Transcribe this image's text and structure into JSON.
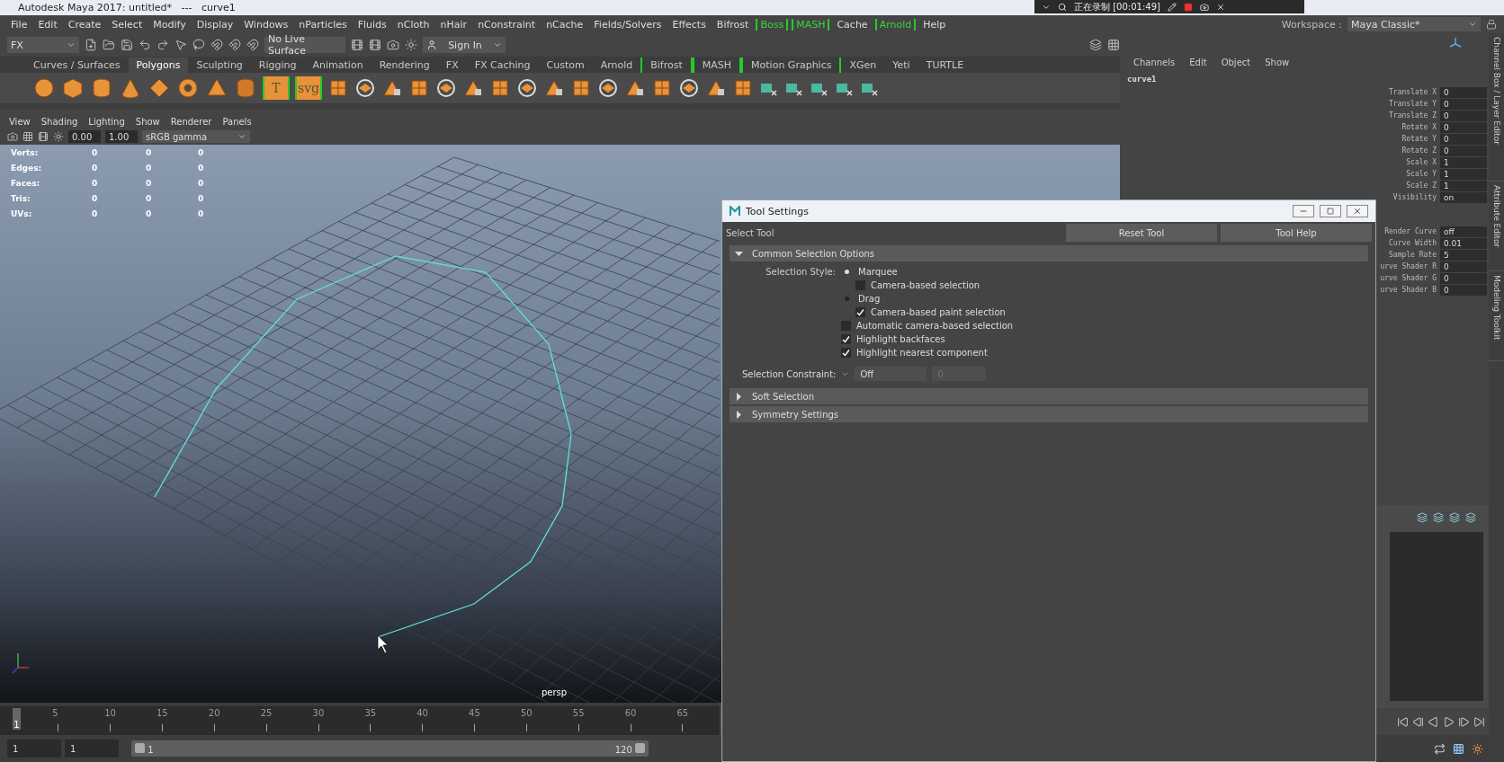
{
  "title_bar": {
    "title": "Autodesk Maya 2017: untitled*   ---   curve1"
  },
  "recorder": {
    "status": "正在录制 [00:01:49]"
  },
  "menu_bar": [
    {
      "label": "File",
      "kind": "plain"
    },
    {
      "label": "Edit",
      "kind": "plain"
    },
    {
      "label": "Create",
      "kind": "plain"
    },
    {
      "label": "Select",
      "kind": "plain"
    },
    {
      "label": "Modify",
      "kind": "plain"
    },
    {
      "label": "Display",
      "kind": "plain"
    },
    {
      "label": "Windows",
      "kind": "plain"
    },
    {
      "label": "nParticles",
      "kind": "plain"
    },
    {
      "label": "Fluids",
      "kind": "plain"
    },
    {
      "label": "nCloth",
      "kind": "plain"
    },
    {
      "label": "nHair",
      "kind": "plain"
    },
    {
      "label": "nConstraint",
      "kind": "plain"
    },
    {
      "label": "nCache",
      "kind": "plain"
    },
    {
      "label": "Fields/Solvers",
      "kind": "plain"
    },
    {
      "label": "Effects",
      "kind": "plain"
    },
    {
      "label": "Bifrost",
      "kind": "plain"
    },
    {
      "label": "Boss",
      "kind": "plugin"
    },
    {
      "label": "MASH",
      "kind": "plugin"
    },
    {
      "label": "Cache",
      "kind": "plain"
    },
    {
      "label": "Arnold",
      "kind": "plugin"
    },
    {
      "label": "Help",
      "kind": "plain"
    }
  ],
  "workspace": {
    "label": "Workspace :",
    "value": "Maya Classic*"
  },
  "status_line": {
    "mode": "FX",
    "live_surface": "No Live Surface",
    "sign_in": "Sign In"
  },
  "shelf_tabs": [
    {
      "label": "Curves / Surfaces",
      "selected": false,
      "kind": "plain"
    },
    {
      "label": "Polygons",
      "selected": true,
      "kind": "plain"
    },
    {
      "label": "Sculpting",
      "selected": false,
      "kind": "plain"
    },
    {
      "label": "Rigging",
      "selected": false,
      "kind": "plain"
    },
    {
      "label": "Animation",
      "selected": false,
      "kind": "plain"
    },
    {
      "label": "Rendering",
      "selected": false,
      "kind": "plain"
    },
    {
      "label": "FX",
      "selected": false,
      "kind": "plain"
    },
    {
      "label": "FX Caching",
      "selected": false,
      "kind": "plain"
    },
    {
      "label": "Custom",
      "selected": false,
      "kind": "plain"
    },
    {
      "label": "Arnold",
      "selected": false,
      "kind": "plain"
    },
    {
      "label": "Bifrost",
      "selected": false,
      "kind": "plugin"
    },
    {
      "label": "MASH",
      "selected": false,
      "kind": "plugin"
    },
    {
      "label": "Motion Graphics",
      "selected": false,
      "kind": "plugin"
    },
    {
      "label": "XGen",
      "selected": false,
      "kind": "plain"
    },
    {
      "label": "Yeti",
      "selected": false,
      "kind": "plain"
    },
    {
      "label": "TURTLE",
      "selected": false,
      "kind": "plain"
    }
  ],
  "shelf_text_tools": [
    "T",
    "svg"
  ],
  "viewport_menu": [
    "View",
    "Shading",
    "Lighting",
    "Show",
    "Renderer",
    "Panels"
  ],
  "viewport_toolbar": {
    "exposure": "0.00",
    "gamma": "1.00",
    "color_space": "sRGB gamma"
  },
  "hud": [
    {
      "label": "Verts:",
      "values": [
        "0",
        "0",
        "0"
      ]
    },
    {
      "label": "Edges:",
      "values": [
        "0",
        "0",
        "0"
      ]
    },
    {
      "label": "Faces:",
      "values": [
        "0",
        "0",
        "0"
      ]
    },
    {
      "label": "Tris:",
      "values": [
        "0",
        "0",
        "0"
      ]
    },
    {
      "label": "UVs:",
      "values": [
        "0",
        "0",
        "0"
      ]
    }
  ],
  "camera_label": "persp",
  "timeline": {
    "current": "1",
    "level": 0,
    "ticks": [
      "5",
      "10",
      "15",
      "20",
      "25",
      "30",
      "35",
      "40",
      "45",
      "50",
      "55",
      "60",
      "65"
    ]
  },
  "range": {
    "start": "1",
    "current": "1",
    "range_start": "1",
    "range_end": "120",
    "level": 1
  },
  "channel_box": {
    "menus": [
      "Channels",
      "Edit",
      "Object",
      "Show"
    ],
    "object": "curve1",
    "attributes": [
      {
        "name": "Translate X",
        "value": "0"
      },
      {
        "name": "Translate Y",
        "value": "0"
      },
      {
        "name": "Translate Z",
        "value": "0"
      },
      {
        "name": "Rotate X",
        "value": "0"
      },
      {
        "name": "Rotate Y",
        "value": "0"
      },
      {
        "name": "Rotate Z",
        "value": "0"
      },
      {
        "name": "Scale X",
        "value": "1"
      },
      {
        "name": "Scale Y",
        "value": "1"
      },
      {
        "name": "Scale Z",
        "value": "1"
      },
      {
        "name": "Visibility",
        "value": "on"
      }
    ],
    "shape_attributes": [
      {
        "name": "Render Curve",
        "value": "off"
      },
      {
        "name": "Curve Width",
        "value": "0.01"
      },
      {
        "name": "Sample Rate",
        "value": "5"
      },
      {
        "name": "urve Shader R",
        "value": "0"
      },
      {
        "name": "urve Shader G",
        "value": "0"
      },
      {
        "name": "urve Shader B",
        "value": "0"
      }
    ]
  },
  "side_tabs": [
    "Channel Box / Layer Editor",
    "Attribute Editor",
    "Modeling Toolkit"
  ],
  "tool_settings": {
    "title": "Tool Settings",
    "tool": "Select Tool",
    "buttons": [
      "Reset Tool",
      "Tool Help"
    ],
    "sections": [
      {
        "label": "Common Selection Options",
        "expanded": true,
        "style_label": "Selection Style:",
        "options": [
          {
            "kind": "radio",
            "label": "Marquee",
            "selected": true,
            "children": [
              {
                "kind": "checkbox",
                "label": "Camera-based selection",
                "checked": false
              }
            ]
          },
          {
            "kind": "radio",
            "label": "Drag",
            "selected": false,
            "children": [
              {
                "kind": "checkbox",
                "label": "Camera-based paint selection",
                "checked": true
              }
            ]
          },
          {
            "kind": "checkbox",
            "label": "Automatic camera-based selection",
            "checked": false
          },
          {
            "kind": "checkbox",
            "label": "Highlight backfaces",
            "checked": true
          },
          {
            "kind": "checkbox",
            "label": "Highlight nearest component",
            "checked": true
          }
        ],
        "constraint": {
          "label": "Selection Constraint:",
          "value": "Off",
          "number": "0"
        }
      },
      {
        "label": "Soft Selection",
        "expanded": false
      },
      {
        "label": "Symmetry Settings",
        "expanded": false
      }
    ]
  }
}
